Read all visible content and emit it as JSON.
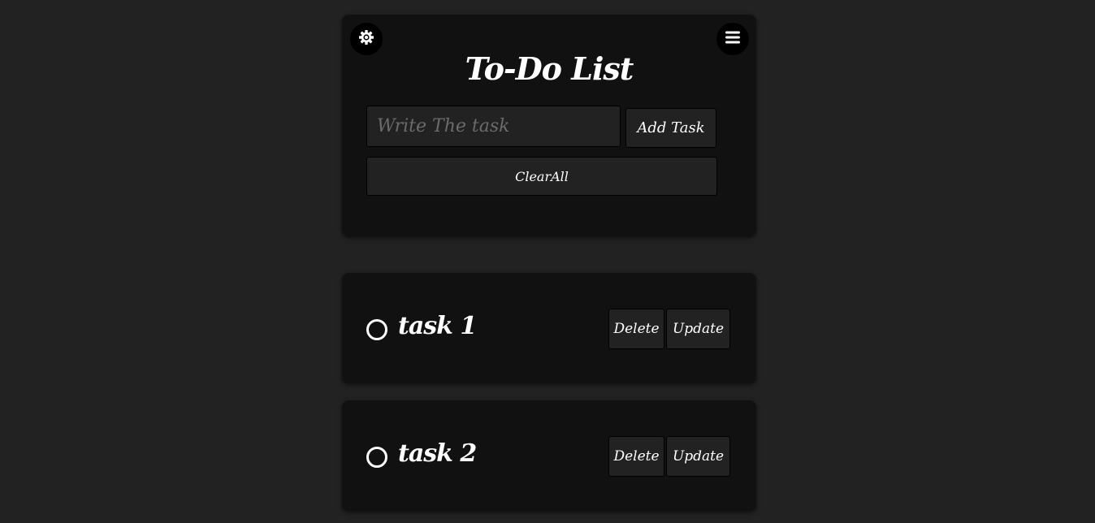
{
  "app": {
    "title": "To-Do List"
  },
  "header": {
    "theme_icon": "gear-icon",
    "menu_icon": "hamburger-menu-icon"
  },
  "form": {
    "input_placeholder": "Write The task",
    "input_value": "",
    "add_label": "Add Task",
    "clear_label": "ClearAll"
  },
  "tasks": [
    {
      "text": "task 1",
      "delete_label": "Delete",
      "update_label": "Update",
      "done": false
    },
    {
      "text": "task 2",
      "delete_label": "Delete",
      "update_label": "Update",
      "done": false
    }
  ],
  "colors": {
    "background": "#222222",
    "card": "#111111",
    "button": "#222222",
    "text": "#ffffff",
    "placeholder": "#6b6b6b"
  }
}
